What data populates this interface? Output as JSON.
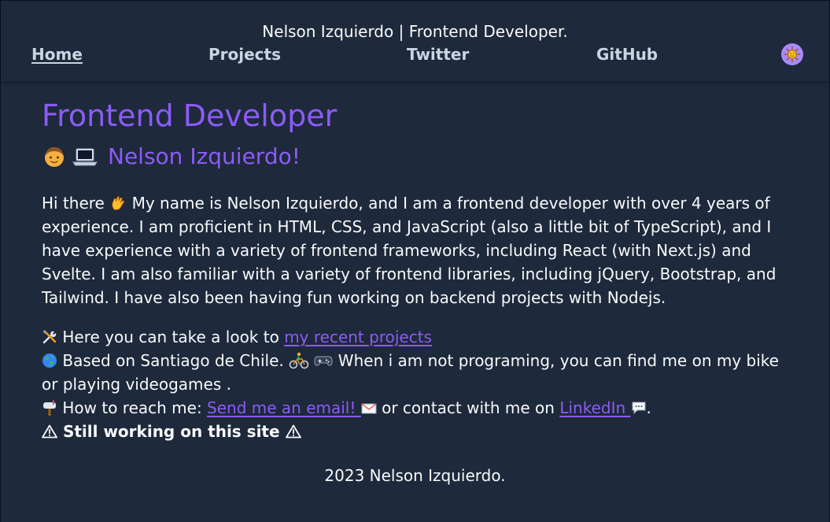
{
  "header": {
    "site_title": "Nelson Izquierdo | Frontend Developer.",
    "nav": [
      {
        "label": "Home",
        "active": true
      },
      {
        "label": "Projects",
        "active": false
      },
      {
        "label": "Twitter",
        "active": false
      },
      {
        "label": "GitHub",
        "active": false
      }
    ],
    "theme_toggle_icon": "sun-icon"
  },
  "main": {
    "heading": "Frontend Developer",
    "subheading_name": "Nelson Izquierdo!",
    "subheading_icons": [
      "person-icon",
      "laptop-icon"
    ],
    "bio_intro": "Hi there",
    "bio_rest": " My name is Nelson Izquierdo, and I am a frontend developer with over 4 years of experience. I am proficient in HTML, CSS, and JavaScript (also a little bit of TypeScript), and I have experience with a variety of frontend frameworks, including React (with Next.js) and Svelte. I am also familiar with a variety of frontend libraries, including jQuery, Bootstrap, and Tailwind. I have also been having fun working on backend projects with Nodejs.",
    "projects_prefix": " Here you can take a look to ",
    "projects_link": "my recent projects",
    "location_text": " Based on Santiago de Chile. ",
    "hobby_text": " When i am not programing, you can find me on my bike or playing videogames .",
    "contact_prefix": " How to reach me: ",
    "email_link": "Send me an email! ",
    "contact_middle": " or contact with me on ",
    "linkedin_link": "LinkedIn ",
    "contact_suffix": ".",
    "warning_text": " Still working on this site "
  },
  "footer": {
    "text": "2023 Nelson Izquierdo."
  },
  "colors": {
    "background": "#1e293b",
    "accent": "#8b5cf6",
    "nav_text": "#cbd5e1",
    "body_text": "#f8fafc"
  }
}
